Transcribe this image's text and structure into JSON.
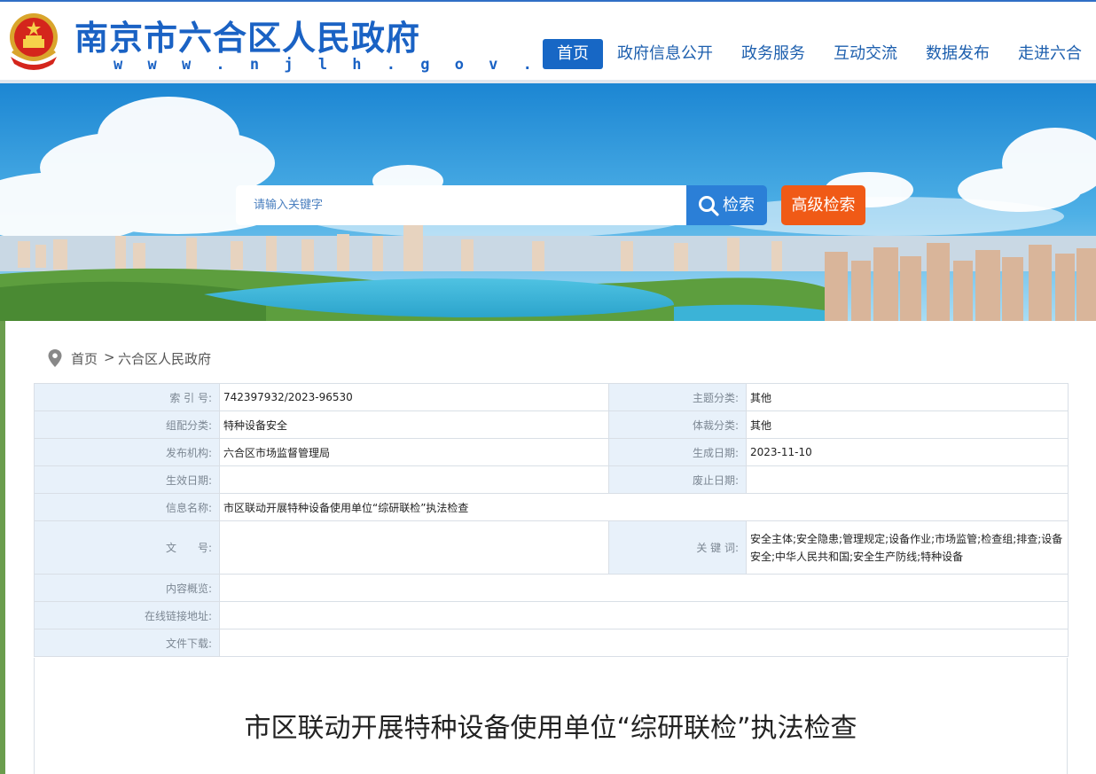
{
  "header": {
    "title": "南京市六合区人民政府",
    "url": "w w w . n j l h . g o v . c n",
    "nav": [
      {
        "label": "首页",
        "active": true
      },
      {
        "label": "政府信息公开",
        "active": false
      },
      {
        "label": "政务服务",
        "active": false
      },
      {
        "label": "互动交流",
        "active": false
      },
      {
        "label": "数据发布",
        "active": false
      },
      {
        "label": "走进六合",
        "active": false
      }
    ]
  },
  "search": {
    "placeholder": "请输入关键字",
    "button_label": "检索",
    "advanced_label": "高级检索"
  },
  "breadcrumb": {
    "home": "首页",
    "separator": ">",
    "current": "六合区人民政府"
  },
  "meta": {
    "index_no_label": "索 引 号:",
    "index_no": "742397932/2023-96530",
    "topic_label": "主题分类:",
    "topic": "其他",
    "category_label": "组配分类:",
    "category": "特种设备安全",
    "genre_label": "体裁分类:",
    "genre": "其他",
    "publisher_label": "发布机构:",
    "publisher": "六合区市场监督管理局",
    "created_label": "生成日期:",
    "created": "2023-11-10",
    "effective_label": "生效日期:",
    "effective": "",
    "abolished_label": "废止日期:",
    "abolished": "",
    "name_label": "信息名称:",
    "name": "市区联动开展特种设备使用单位“综研联检”执法检查",
    "docno_label": "文　　号:",
    "docno": "",
    "keywords_label": "关 键 词:",
    "keywords": "安全主体;安全隐患;管理规定;设备作业;市场监管;检查组;排查;设备安全;中华人民共和国;安全生产防线;特种设备",
    "summary_label": "内容概览:",
    "summary": "",
    "link_label": "在线链接地址:",
    "link": "",
    "download_label": "文件下载:",
    "download": ""
  },
  "article": {
    "title": "市区联动开展特种设备使用单位“综研联检”执法检查"
  },
  "colors": {
    "brand": "#1a62c4",
    "nav_active": "#1767c5",
    "search_button": "#2b7fd7",
    "advanced_button": "#f05a16",
    "label_cell_bg": "#e8f1fa"
  },
  "icons": [
    "national-emblem-icon",
    "search-icon",
    "location-pin-icon"
  ]
}
